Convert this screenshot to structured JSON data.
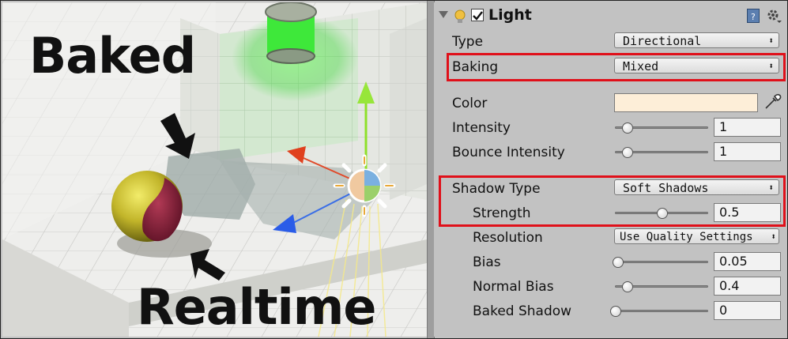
{
  "scene": {
    "label_baked": "Baked",
    "label_realtime": "Realtime"
  },
  "inspector": {
    "component_title": "Light",
    "component_enabled": true,
    "fields": {
      "type": {
        "label": "Type",
        "value": "Directional"
      },
      "baking": {
        "label": "Baking",
        "value": "Mixed"
      },
      "color": {
        "label": "Color",
        "value": "#fdeed8"
      },
      "intensity": {
        "label": "Intensity",
        "value": "1",
        "slider_fraction": 0.125
      },
      "bounce_intensity": {
        "label": "Bounce Intensity",
        "value": "1",
        "slider_fraction": 0.125
      },
      "shadow_type": {
        "label": "Shadow Type",
        "value": "Soft Shadows"
      },
      "strength": {
        "label": "Strength",
        "value": "0.5",
        "slider_fraction": 0.5
      },
      "resolution": {
        "label": "Resolution",
        "value": "Use Quality Settings"
      },
      "bias": {
        "label": "Bias",
        "value": "0.05",
        "slider_fraction": 0.025
      },
      "normal_bias": {
        "label": "Normal Bias",
        "value": "0.4",
        "slider_fraction": 0.13
      },
      "baked_shadow": {
        "label": "Baked Shadow",
        "value": "0",
        "slider_fraction": 0.0
      }
    },
    "highlight_color": "#e0101a",
    "icons": {
      "foldout": "triangle-down-icon",
      "light": "lightbulb-icon",
      "help": "help-book-icon",
      "settings": "gear-icon",
      "eyedropper": "eyedropper-icon"
    }
  }
}
